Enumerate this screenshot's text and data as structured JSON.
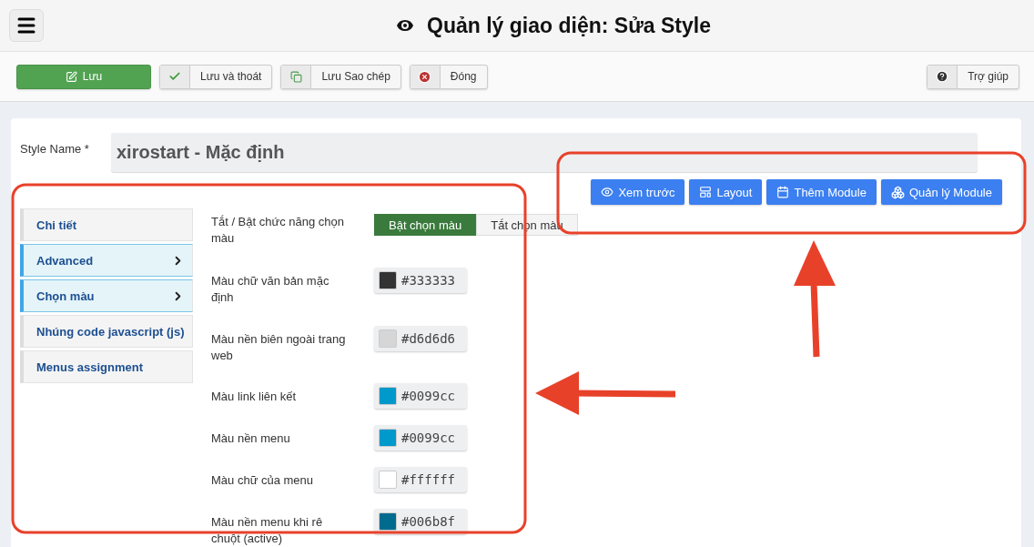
{
  "header": {
    "title": "Quản lý giao diện: Sửa Style"
  },
  "toolbar": {
    "buttons": [
      {
        "label": "Lưu",
        "kind": "primary"
      },
      {
        "label": "Lưu và thoát",
        "kind": "check"
      },
      {
        "label": "Lưu Sao chép",
        "kind": "copy"
      },
      {
        "label": "Đóng",
        "kind": "close"
      }
    ],
    "help": {
      "label": "Trợ giúp"
    }
  },
  "style_name": {
    "label": "Style Name *",
    "value": "xirostart - Mặc định"
  },
  "actions": [
    {
      "label": "Xem trước",
      "kind": "eye"
    },
    {
      "label": "Layout",
      "kind": "layout"
    },
    {
      "label": "Thêm Module",
      "kind": "calendar"
    },
    {
      "label": "Quản lý Module",
      "kind": "cubes"
    }
  ],
  "tabs": [
    {
      "label": "Chi tiết",
      "selected": false,
      "expandable": false
    },
    {
      "label": "Advanced",
      "selected": true,
      "expandable": true
    },
    {
      "label": "Chọn màu",
      "selected": true,
      "expandable": true
    },
    {
      "label": "Nhúng code javascript (js)",
      "selected": false,
      "expandable": false
    },
    {
      "label": "Menus assignment",
      "selected": false,
      "expandable": false
    }
  ],
  "toggle": {
    "label": "Tắt / Bật chức năng chọn màu",
    "options": [
      {
        "label": "Bật chọn màu",
        "selected": true
      },
      {
        "label": "Tắt chọn màu",
        "selected": false
      }
    ]
  },
  "colors": [
    {
      "label": "Màu chữ văn bản mặc định",
      "value": "#333333",
      "color": "#333333"
    },
    {
      "label": "Màu nền biên ngoài trang web",
      "value": "#d6d6d6",
      "color": "#d6d6d6"
    },
    {
      "label": "Màu link liên kết",
      "value": "#0099cc",
      "color": "#0099cc"
    },
    {
      "label": "Màu nền menu",
      "value": "#0099cc",
      "color": "#0099cc"
    },
    {
      "label": "Màu chữ của menu",
      "value": "#ffffff",
      "color": "#ffffff"
    },
    {
      "label": "Màu nền menu khi rê chuột (active)",
      "value": "#006b8f",
      "color": "#006b8f"
    }
  ]
}
